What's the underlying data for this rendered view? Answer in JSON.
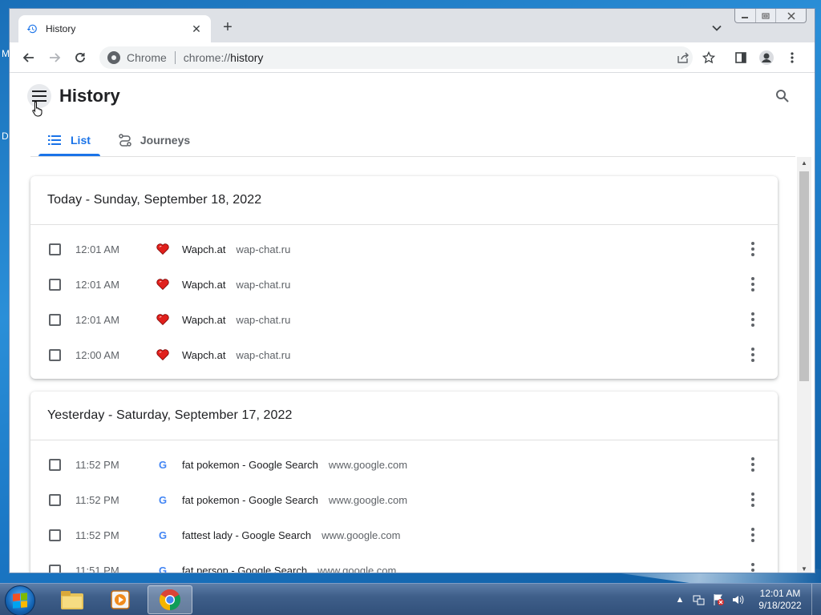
{
  "desktop": {
    "letters": [
      "M",
      "D"
    ]
  },
  "browser": {
    "tab": {
      "title": "History",
      "close": "✕"
    },
    "new_tab": "+",
    "omnibox": {
      "label": "Chrome",
      "scheme": "chrome://",
      "host": "history"
    }
  },
  "page": {
    "title": "History",
    "tabs": [
      {
        "label": "List",
        "active": true
      },
      {
        "label": "Journeys",
        "active": false
      }
    ],
    "groups": [
      {
        "heading": "Today - Sunday, September 18, 2022",
        "entries": [
          {
            "time": "12:01 AM",
            "favicon": "heart-icon",
            "title": "Wapch.at",
            "domain": "wap-chat.ru"
          },
          {
            "time": "12:01 AM",
            "favicon": "heart-icon",
            "title": "Wapch.at",
            "domain": "wap-chat.ru"
          },
          {
            "time": "12:01 AM",
            "favicon": "heart-icon",
            "title": "Wapch.at",
            "domain": "wap-chat.ru"
          },
          {
            "time": "12:00 AM",
            "favicon": "heart-icon",
            "title": "Wapch.at",
            "domain": "wap-chat.ru"
          }
        ]
      },
      {
        "heading": "Yesterday - Saturday, September 17, 2022",
        "entries": [
          {
            "time": "11:52 PM",
            "favicon": "google-icon",
            "title": "fat pokemon - Google Search",
            "domain": "www.google.com"
          },
          {
            "time": "11:52 PM",
            "favicon": "google-icon",
            "title": "fat pokemon - Google Search",
            "domain": "www.google.com"
          },
          {
            "time": "11:52 PM",
            "favicon": "google-icon",
            "title": "fattest lady - Google Search",
            "domain": "www.google.com"
          },
          {
            "time": "11:51 PM",
            "favicon": "google-icon",
            "title": "fat person - Google Search",
            "domain": "www.google.com"
          }
        ]
      }
    ]
  },
  "taskbar": {
    "clock_time": "12:01 AM",
    "clock_date": "9/18/2022"
  },
  "colors": {
    "accent": "#1a73e8",
    "heart": "#e0201c"
  }
}
